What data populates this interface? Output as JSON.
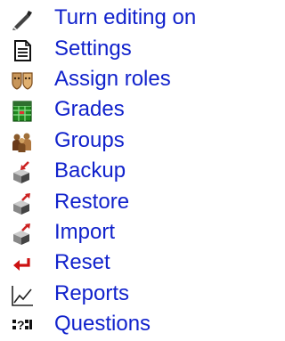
{
  "menu": {
    "items": [
      {
        "label": "Turn editing on",
        "icon": "edit-icon"
      },
      {
        "label": "Settings",
        "icon": "settings-icon"
      },
      {
        "label": "Assign roles",
        "icon": "roles-icon"
      },
      {
        "label": "Grades",
        "icon": "grades-icon"
      },
      {
        "label": "Groups",
        "icon": "groups-icon"
      },
      {
        "label": "Backup",
        "icon": "backup-icon"
      },
      {
        "label": "Restore",
        "icon": "restore-icon"
      },
      {
        "label": "Import",
        "icon": "import-icon"
      },
      {
        "label": "Reset",
        "icon": "reset-icon"
      },
      {
        "label": "Reports",
        "icon": "reports-icon"
      },
      {
        "label": "Questions",
        "icon": "questions-icon"
      }
    ]
  },
  "colors": {
    "link": "#1122cc",
    "background": "#ffffff",
    "reset_arrow": "#cc1111",
    "grades_green": "#1f8a1f",
    "roles_tan": "#c8965a"
  }
}
